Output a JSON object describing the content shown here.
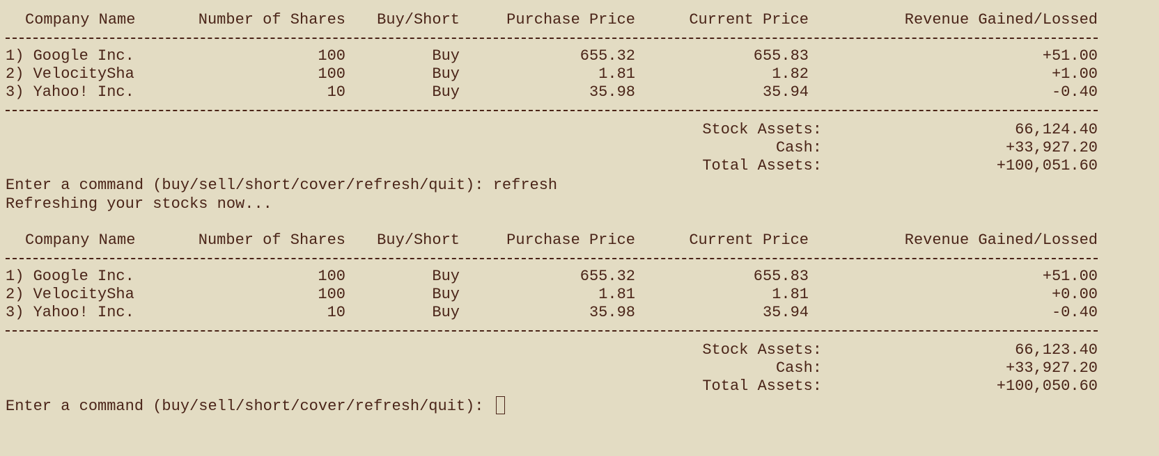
{
  "headers": {
    "company": "Company Name",
    "shares": "Number of Shares",
    "buy_short": "Buy/Short",
    "purchase": "Purchase Price",
    "current": "Current Price",
    "revenue": "Revenue Gained/Lossed"
  },
  "table1": {
    "rows": [
      {
        "company": "1) Google Inc.",
        "shares": "100",
        "buy_short": "Buy",
        "purchase": "655.32",
        "current": "655.83",
        "revenue": "+51.00"
      },
      {
        "company": "2) VelocitySha",
        "shares": "100",
        "buy_short": "Buy",
        "purchase": "1.81",
        "current": "1.82",
        "revenue": "+1.00"
      },
      {
        "company": "3) Yahoo! Inc.",
        "shares": "10",
        "buy_short": "Buy",
        "purchase": "35.98",
        "current": "35.94",
        "revenue": "-0.40"
      }
    ],
    "summary": [
      {
        "label": "Stock Assets:",
        "value": "66,124.40"
      },
      {
        "label": "Cash:",
        "value": "+33,927.20"
      },
      {
        "label": "Total Assets:",
        "value": "+100,051.60"
      }
    ]
  },
  "prompt1": "Enter a command (buy/sell/short/cover/refresh/quit): refresh",
  "refresh_msg": "Refreshing your stocks now...",
  "table2": {
    "rows": [
      {
        "company": "1) Google Inc.",
        "shares": "100",
        "buy_short": "Buy",
        "purchase": "655.32",
        "current": "655.83",
        "revenue": "+51.00"
      },
      {
        "company": "2) VelocitySha",
        "shares": "100",
        "buy_short": "Buy",
        "purchase": "1.81",
        "current": "1.81",
        "revenue": "+0.00"
      },
      {
        "company": "3) Yahoo! Inc.",
        "shares": "10",
        "buy_short": "Buy",
        "purchase": "35.98",
        "current": "35.94",
        "revenue": "-0.40"
      }
    ],
    "summary": [
      {
        "label": "Stock Assets:",
        "value": "66,123.40"
      },
      {
        "label": "Cash:",
        "value": "+33,927.20"
      },
      {
        "label": "Total Assets:",
        "value": "+100,050.60"
      }
    ]
  },
  "prompt2": "Enter a command (buy/sell/short/cover/refresh/quit): ",
  "colors": {
    "background": "#e3dcc3",
    "text": "#4a2418"
  }
}
